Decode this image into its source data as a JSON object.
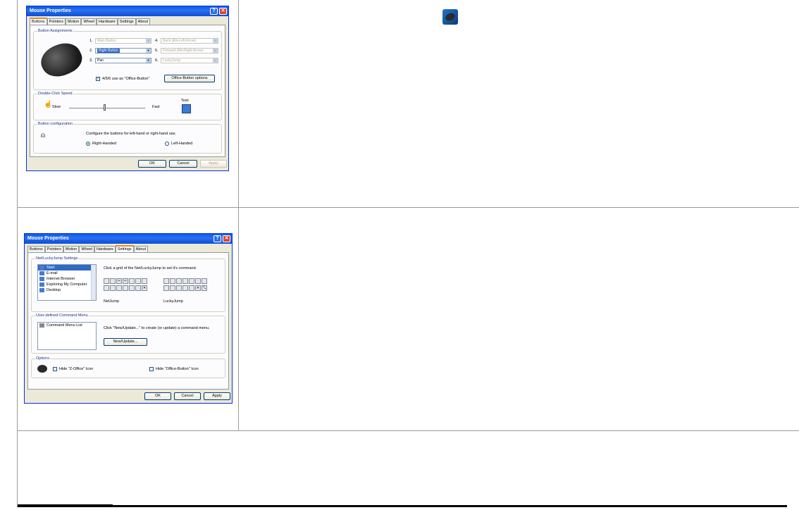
{
  "dialog1": {
    "title": "Mouse Properties",
    "tabs": [
      "Buttons",
      "Pointers",
      "Motion",
      "Wheel",
      "Hardware",
      "Settings",
      "About"
    ],
    "button_assignments_title": "Button Assignments",
    "assignments": [
      {
        "num": "1.",
        "value": "Main Button"
      },
      {
        "num": "2.",
        "value": "Right Button"
      },
      {
        "num": "3.",
        "value": "Pan"
      },
      {
        "num": "4.",
        "value": "Back (Alt+Left Arrow)"
      },
      {
        "num": "5.",
        "value": "Forward (Alt+Right Arrow)"
      },
      {
        "num": "6.",
        "value": "LuckyJump"
      }
    ],
    "office_checkbox_label": "4/5/6 use as \"Office-Button\"",
    "office_button": "Office-Button options",
    "dbl_title": "Double-Click Speed",
    "slow": "Slow",
    "fast": "Fast",
    "test": "Test:",
    "slider_value": 0.45,
    "config_title": "Button configuration",
    "config_text": "Configure the buttons for left-hand or right-hand use.",
    "right_handed": "Right-Handed",
    "left_handed": "Left-Handed",
    "ok": "OK",
    "cancel": "Cancel",
    "apply": "Apply"
  },
  "dialog2": {
    "title": "Mouse Properties",
    "tabs": [
      "Buttons",
      "Pointers",
      "Motion",
      "Wheel",
      "Hardware",
      "Settings",
      "About"
    ],
    "netlucky_title": "Net/LuckyJump Settings",
    "list_items": [
      "Start",
      "E-mail",
      "Internet Browser",
      "Exploring My Computer",
      "Desktop"
    ],
    "click_text": "Click a grid of the Net/LuckyJump to set it's command.",
    "netjump": "NetJump",
    "luckyjump": "LuckyJump",
    "user_menu_title": "User-defined Command Menu",
    "command_list": "Command Menu List",
    "new_update_text": "Click \"New/Update...\" to create (or update) a command menu.",
    "new_update_button": "New/Update...",
    "options_title": "Options",
    "hide_zx": "Hide \"Z-Office\" Icon",
    "hide_office": "Hide \"Office-Button\" Icon",
    "ok": "OK",
    "cancel": "Cancel",
    "apply": "Apply"
  },
  "colors": {
    "titlebar": "#0a5cf0",
    "dialog_bg": "#ece9d8",
    "selection": "#316ac5"
  }
}
